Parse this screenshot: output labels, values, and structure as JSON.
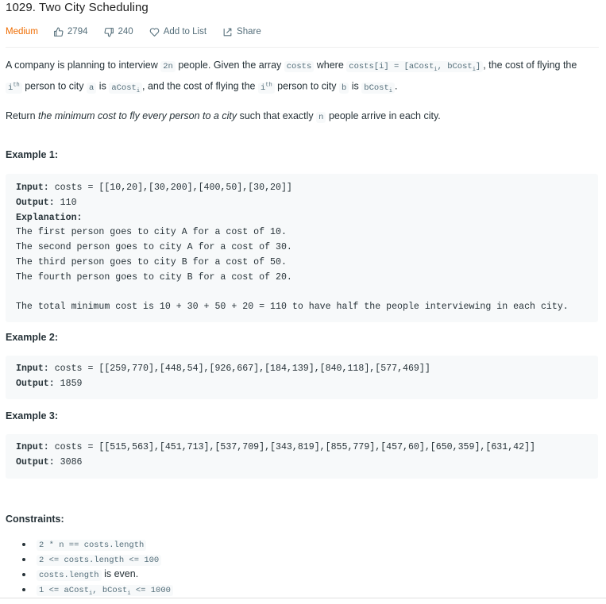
{
  "problem": {
    "title": "1029. Two City Scheduling",
    "difficulty": "Medium",
    "likes": "2794",
    "dislikes": "240",
    "add_to_list": "Add to List",
    "share": "Share",
    "difficulty_color": "#ef6c00"
  },
  "description": {
    "p1_a": "A company is planning to interview ",
    "p1_code_2n": "2n",
    "p1_b": " people. Given the array ",
    "p1_code_costs": "costs",
    "p1_c": " where ",
    "p1_code_costs_i": "costs[i] = [aCost",
    "p1_code_sub_i": "i",
    "p1_code_mid": ", bCost",
    "p1_code_end": "]",
    "p1_d": ", the cost of flying the ",
    "p1_code_ith1": "i",
    "p1_sup_th": "th",
    "p1_e": " person to city ",
    "p1_code_a": "a",
    "p1_f": " is ",
    "p1_code_acost": "aCost",
    "p1_g": ", and the cost of flying the ",
    "p1_h": " person to city ",
    "p1_code_b": "b",
    "p1_code_bcost": "bCost",
    "p1_i": ".",
    "p2_a": "Return ",
    "p2_em": "the minimum cost to fly every person to a city",
    "p2_b": " such that exactly ",
    "p2_code_n": "n",
    "p2_c": " people arrive in each city."
  },
  "examples": [
    {
      "heading": "Example 1:",
      "input_label": "Input:",
      "input_value": " costs = [[10,20],[30,200],[400,50],[30,20]]",
      "output_label": "Output:",
      "output_value": " 110",
      "explanation_label": "Explanation:",
      "explanation_lines": [
        "The first person goes to city A for a cost of 10.",
        "The second person goes to city A for a cost of 30.",
        "The third person goes to city B for a cost of 50.",
        "The fourth person goes to city B for a cost of 20.",
        "",
        "The total minimum cost is 10 + 30 + 50 + 20 = 110 to have half the people interviewing in each city."
      ]
    },
    {
      "heading": "Example 2:",
      "input_label": "Input:",
      "input_value": " costs = [[259,770],[448,54],[926,667],[184,139],[840,118],[577,469]]",
      "output_label": "Output:",
      "output_value": " 1859"
    },
    {
      "heading": "Example 3:",
      "input_label": "Input:",
      "input_value": " costs = [[515,563],[451,713],[537,709],[343,819],[855,779],[457,60],[650,359],[631,42]]",
      "output_label": "Output:",
      "output_value": " 3086"
    }
  ],
  "constraints": {
    "heading": "Constraints:",
    "c1_code": "2 * n == costs.length",
    "c2_code": "2 <= costs.length <= 100",
    "c3_code": "costs.length",
    "c3_text": " is even.",
    "c4_code_a": "1 <= aCost",
    "c4_code_sub": "i",
    "c4_code_b": ", bCost",
    "c4_code_c": " <= 1000"
  }
}
